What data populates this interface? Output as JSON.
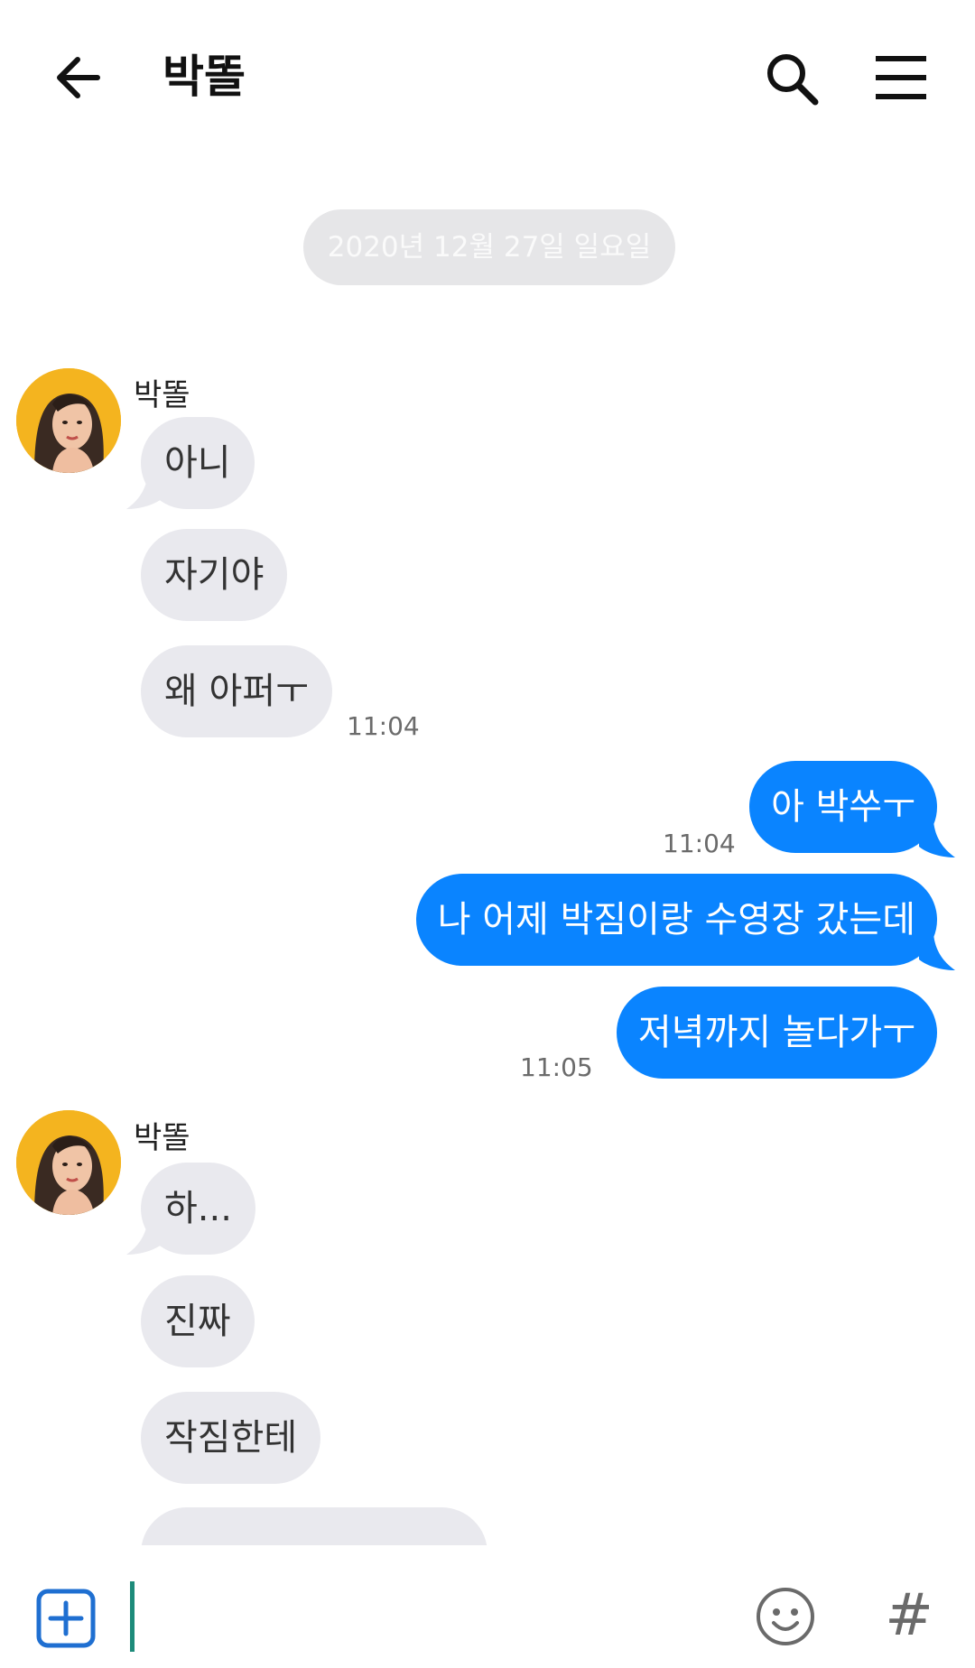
{
  "header": {
    "title": "박똘",
    "back_icon": "arrow-left-icon",
    "search_icon": "search-icon",
    "menu_icon": "hamburger-menu-icon"
  },
  "date_divider": "2020년 12월 27일 일요일",
  "colors": {
    "outgoing_bubble": "#0a84ff",
    "incoming_bubble": "#e9e9ee",
    "cursor": "#1d8b7a",
    "accent": "#1f6fd1"
  },
  "groups": [
    {
      "sender": "박똘",
      "messages": [
        "아니",
        "자기야",
        "왜 아퍼ㅜ"
      ],
      "time": "11:04"
    },
    {
      "outgoing": true,
      "messages": [
        "아 박쑤ㅜ"
      ],
      "time": "11:04"
    },
    {
      "outgoing": true,
      "messages": [
        "나 어제 박짐이랑 수영장 갔는데",
        "저녁까지 놀다가ㅜ"
      ],
      "time": "11:05"
    },
    {
      "sender": "박똘",
      "messages": [
        "하...",
        "진짜",
        "작짐한테"
      ]
    }
  ],
  "composer": {
    "add_icon": "plus-square-icon",
    "emoji_icon": "smiley-icon",
    "hashtag_icon": "hashtag-icon",
    "hashtag_glyph": "#",
    "placeholder": ""
  }
}
